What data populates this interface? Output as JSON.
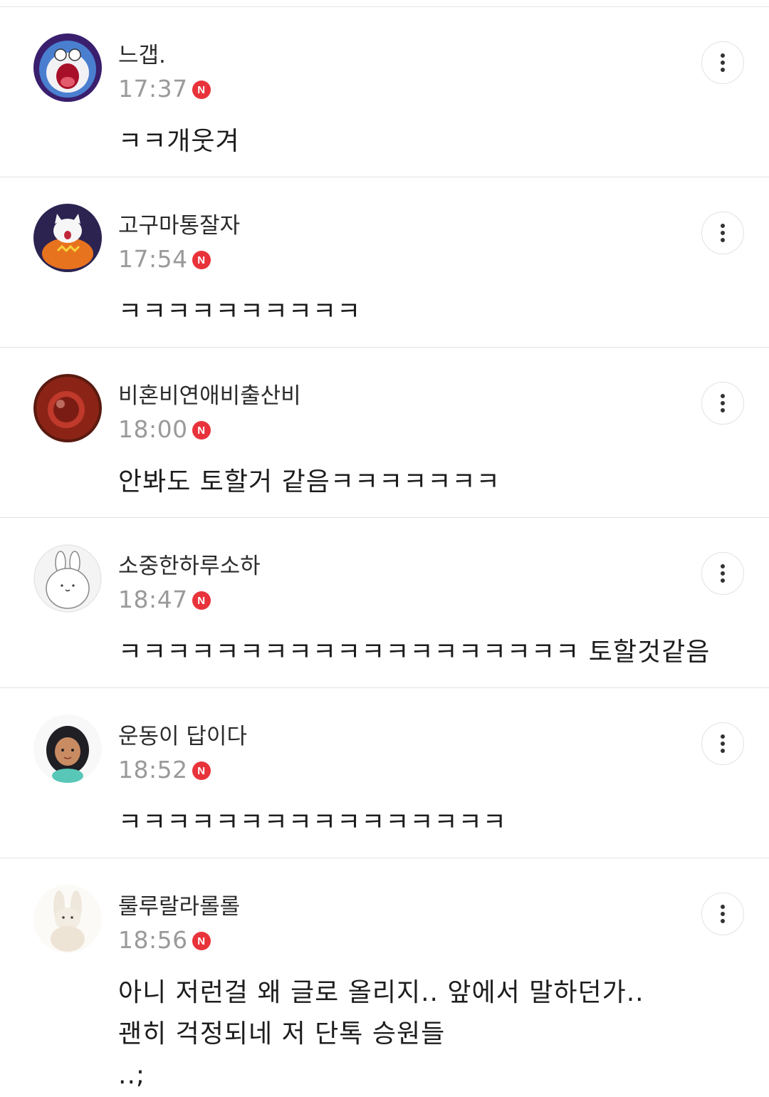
{
  "comments": [
    {
      "nickname": "느갭.",
      "time": "17:37",
      "badge": "N",
      "text": "ㅋㅋ개웃겨",
      "avatar": "doraemon-avatar"
    },
    {
      "nickname": "고구마통잘자",
      "time": "17:54",
      "badge": "N",
      "text": "ㅋㅋㅋㅋㅋㅋㅋㅋㅋㅋ",
      "avatar": "cat-pumpkin-avatar"
    },
    {
      "nickname": "비혼비연애비출산비",
      "time": "18:00",
      "badge": "N",
      "text": "안봐도 토할거 같음ㅋㅋㅋㅋㅋㅋㅋ",
      "avatar": "red-ornament-avatar"
    },
    {
      "nickname": "소중한하루소하",
      "time": "18:47",
      "badge": "N",
      "text": "ㅋㅋㅋㅋㅋㅋㅋㅋㅋㅋㅋㅋㅋㅋㅋㅋㅋㅋㅋ 토할것같음",
      "avatar": "bunny-avatar"
    },
    {
      "nickname": "운동이 답이다",
      "time": "18:52",
      "badge": "N",
      "text": "ㅋㅋㅋㅋㅋㅋㅋㅋㅋㅋㅋㅋㅋㅋㅋㅋ",
      "avatar": "princess-avatar"
    },
    {
      "nickname": "룰루랄라롤롤",
      "time": "18:56",
      "badge": "N",
      "text": "아니 저런걸 왜 글로 올리지.. 앞에서 말하던가..\n괜히 걱정되네 저 단톡 승원들\n..;",
      "avatar": "plush-bunny-avatar"
    }
  ],
  "colors": {
    "badge": "#e8333b",
    "time": "#9a9a9a",
    "divider": "#e3e3e3"
  }
}
